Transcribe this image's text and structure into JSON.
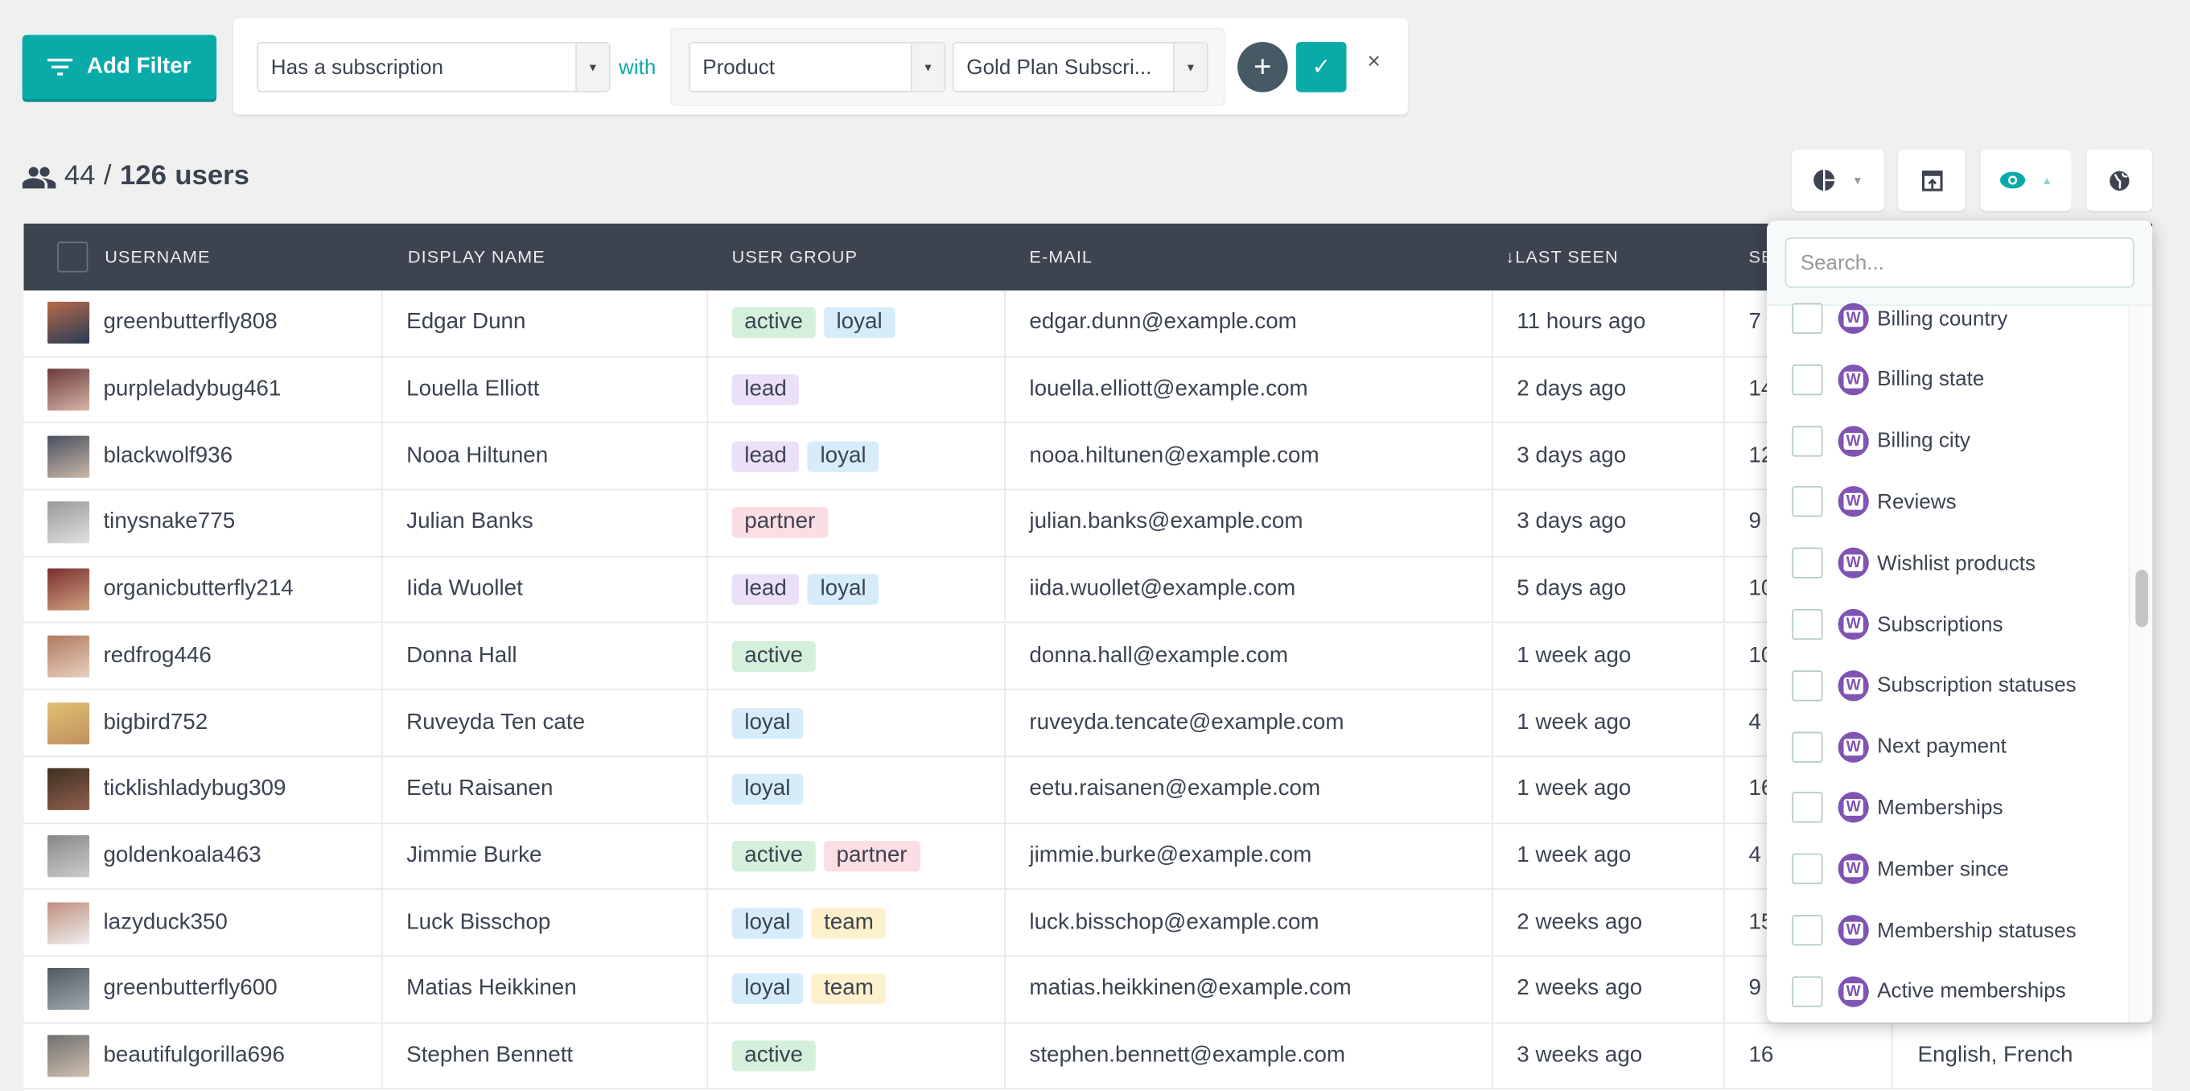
{
  "filter": {
    "add_filter_label": "Add Filter",
    "condition": "Has a subscription",
    "with_label": "with",
    "field": "Product",
    "value": "Gold Plan Subscri...",
    "add_label": "+",
    "apply_label": "✓",
    "remove_label": "×"
  },
  "summary": {
    "filtered": "44",
    "separator": "/",
    "total": "126",
    "unit": "users"
  },
  "toolbar": {
    "icons": [
      "pie-chart-icon",
      "export-icon",
      "eye-icon",
      "globe-icon"
    ],
    "accent": "#08aba8"
  },
  "table": {
    "headers": [
      "USERNAME",
      "DISPLAY NAME",
      "USER GROUP",
      "E-MAIL",
      "↓LAST SEEN",
      "SE"
    ],
    "rows": [
      {
        "username": "greenbutterfly808",
        "name": "Edgar Dunn",
        "groups": [
          "active",
          "loyal"
        ],
        "email": "edgar.dunn@example.com",
        "last_seen": "11 hours ago",
        "count": "7",
        "lang": ""
      },
      {
        "username": "purpleladybug461",
        "name": "Louella Elliott",
        "groups": [
          "lead"
        ],
        "email": "louella.elliott@example.com",
        "last_seen": "2 days ago",
        "count": "14",
        "lang": ""
      },
      {
        "username": "blackwolf936",
        "name": "Nooa Hiltunen",
        "groups": [
          "lead",
          "loyal"
        ],
        "email": "nooa.hiltunen@example.com",
        "last_seen": "3 days ago",
        "count": "12",
        "lang": ""
      },
      {
        "username": "tinysnake775",
        "name": "Julian Banks",
        "groups": [
          "partner"
        ],
        "email": "julian.banks@example.com",
        "last_seen": "3 days ago",
        "count": "9",
        "lang": ""
      },
      {
        "username": "organicbutterfly214",
        "name": "Iida Wuollet",
        "groups": [
          "lead",
          "loyal"
        ],
        "email": "iida.wuollet@example.com",
        "last_seen": "5 days ago",
        "count": "10",
        "lang": ""
      },
      {
        "username": "redfrog446",
        "name": "Donna Hall",
        "groups": [
          "active"
        ],
        "email": "donna.hall@example.com",
        "last_seen": "1 week ago",
        "count": "10",
        "lang": ""
      },
      {
        "username": "bigbird752",
        "name": "Ruveyda Ten cate",
        "groups": [
          "loyal"
        ],
        "email": "ruveyda.tencate@example.com",
        "last_seen": "1 week ago",
        "count": "4",
        "lang": ""
      },
      {
        "username": "ticklishladybug309",
        "name": "Eetu Raisanen",
        "groups": [
          "loyal"
        ],
        "email": "eetu.raisanen@example.com",
        "last_seen": "1 week ago",
        "count": "16",
        "lang": ""
      },
      {
        "username": "goldenkoala463",
        "name": "Jimmie Burke",
        "groups": [
          "active",
          "partner"
        ],
        "email": "jimmie.burke@example.com",
        "last_seen": "1 week ago",
        "count": "4",
        "lang": ""
      },
      {
        "username": "lazyduck350",
        "name": "Luck Bisschop",
        "groups": [
          "loyal",
          "team"
        ],
        "email": "luck.bisschop@example.com",
        "last_seen": "2 weeks ago",
        "count": "15",
        "lang": ""
      },
      {
        "username": "greenbutterfly600",
        "name": "Matias Heikkinen",
        "groups": [
          "loyal",
          "team"
        ],
        "email": "matias.heikkinen@example.com",
        "last_seen": "2 weeks ago",
        "count": "9",
        "lang": ""
      },
      {
        "username": "beautifulgorilla696",
        "name": "Stephen Bennett",
        "groups": [
          "active"
        ],
        "email": "stephen.bennett@example.com",
        "last_seen": "3 weeks ago",
        "count": "16",
        "lang": "English, French"
      }
    ],
    "group_colors": {
      "active": "#d4f0dc",
      "loyal": "#d6ecfb",
      "lead": "#ece0f8",
      "partner": "#fbdde4",
      "team": "#fcf1cc"
    }
  },
  "column_picker": {
    "search_placeholder": "Search...",
    "items": [
      "Billing country",
      "Billing state",
      "Billing city",
      "Reviews",
      "Wishlist products",
      "Subscriptions",
      "Subscription statuses",
      "Next payment",
      "Memberships",
      "Member since",
      "Membership statuses",
      "Active memberships"
    ],
    "item_icon": "woocommerce-icon",
    "icon_letter": "W",
    "icon_color": "#7f54b3"
  }
}
